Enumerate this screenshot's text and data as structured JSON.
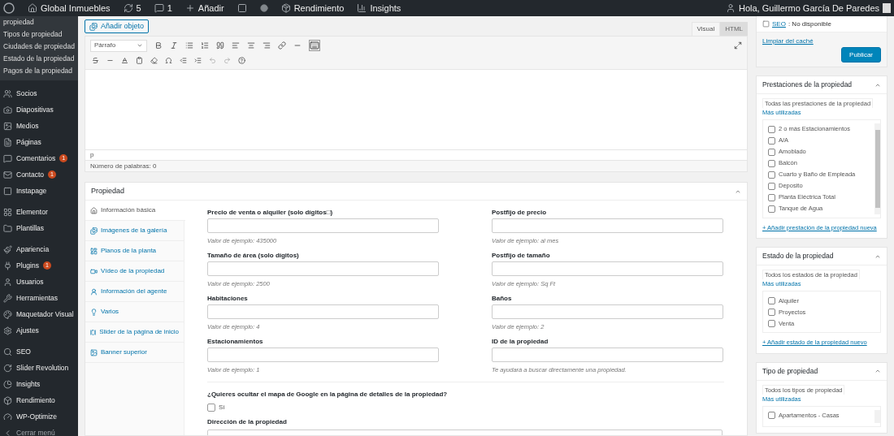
{
  "admin_bar": {
    "site": "Global Inmuebles",
    "updates": "5",
    "comments": "1",
    "new": "Añadir",
    "performance": "Rendimiento",
    "insights": "Insights",
    "greeting": "Hola, Guillermo García De Paredes"
  },
  "sidebar": {
    "submenu": [
      "propiedad",
      "Tipos de propiedad",
      "Ciudades de propiedad",
      "Estado de la propiedad",
      "Pagos de la propiedad"
    ],
    "groups": [
      [
        {
          "label": "Socios"
        },
        {
          "label": "Diapositivas"
        },
        {
          "label": "Medios"
        },
        {
          "label": "Páginas"
        },
        {
          "label": "Comentarios",
          "badge": "1"
        },
        {
          "label": "Contacto",
          "badge": "1"
        },
        {
          "label": "Instapage"
        }
      ],
      [
        {
          "label": "Elementor"
        },
        {
          "label": "Plantillas"
        }
      ],
      [
        {
          "label": "Apariencia"
        },
        {
          "label": "Plugins",
          "badge": "1"
        },
        {
          "label": "Usuarios"
        },
        {
          "label": "Herramientas"
        },
        {
          "label": "Maquetador Visual"
        },
        {
          "label": "Ajustes"
        }
      ],
      [
        {
          "label": "SEO"
        },
        {
          "label": "Slider Revolution"
        },
        {
          "label": "Insights"
        },
        {
          "label": "Rendimiento"
        },
        {
          "label": "WP-Optimize"
        },
        {
          "label": "Cerrar menú",
          "kind": "collapse"
        }
      ]
    ]
  },
  "editor": {
    "add_media": "Añadir objeto",
    "tabs": [
      {
        "label": "Visual",
        "selected": true
      },
      {
        "label": "HTML",
        "selected": false
      }
    ],
    "format": "Párrafo",
    "path": "p",
    "word_count": "Número de palabras: 0"
  },
  "property_box": {
    "title": "Propiedad",
    "tabs": [
      {
        "label": "Información básica",
        "selected": true
      },
      {
        "label": "Imágenes de la galería",
        "selected": false
      },
      {
        "label": "Planos de la planta",
        "selected": false
      },
      {
        "label": "Vídeo de la propiedad",
        "selected": false
      },
      {
        "label": "Información del agente",
        "selected": false
      },
      {
        "label": "Varios",
        "selected": false
      },
      {
        "label": "Slider de la página de inicio",
        "selected": false
      },
      {
        "label": "Banner superior",
        "selected": false
      }
    ],
    "fields": [
      {
        "label": "Precio de venta o alquiler (solo dígitos□)",
        "hint": "Valor de ejemplo: 435000"
      },
      {
        "label": "Postfijo de precio",
        "hint": "Valor de ejemplo: al mes"
      },
      {
        "label": "Tamaño de área (solo dígitos)",
        "hint": "Valor de ejemplo: 2500"
      },
      {
        "label": "Postfijo de tamaño",
        "hint": "Valor de ejemplo: Sq Ft"
      },
      {
        "label": "Habitaciones",
        "hint": "Valor de ejemplo: 4"
      },
      {
        "label": "Baños",
        "hint": "Valor de ejemplo: 2"
      },
      {
        "label": "Estacionamientos",
        "hint": "Valor de ejemplo: 1"
      },
      {
        "label": "ID de la propiedad",
        "hint": "Te ayudará a buscar directamente una propiedad."
      }
    ],
    "map_question": "¿Quieres ocultar el mapa de Google en la página de detalles de la propiedad?",
    "map_option": {
      "label": "Sí",
      "checked": false
    },
    "address_label": "Dirección de la propiedad"
  },
  "publish": {
    "seo_link": "SEO",
    "seo_value": ": No disponible",
    "clear_cache": "Limpiar del caché",
    "publish": "Publicar"
  },
  "taxonomies": [
    {
      "title": "Prestaciones de la propiedad",
      "tabs": [
        {
          "label": "Todas las prestaciones de la propiedad",
          "selected": true
        },
        {
          "label": "Más utilizadas",
          "selected": false
        }
      ],
      "scrollable": true,
      "items": [
        {
          "label": "2 o más Estacionamientos",
          "checked": false
        },
        {
          "label": "A/A",
          "checked": false
        },
        {
          "label": "Amoblado",
          "checked": false
        },
        {
          "label": "Balcón",
          "checked": false
        },
        {
          "label": "Cuarto y Baño de Empleada",
          "checked": false
        },
        {
          "label": "Deposito",
          "checked": false
        },
        {
          "label": "Planta Eléctrica Total",
          "checked": false
        },
        {
          "label": "Tanque de Agua",
          "checked": false
        }
      ],
      "add_link": "+ Añadir prestación de la propiedad nueva"
    },
    {
      "title": "Estado de la propiedad",
      "tabs": [
        {
          "label": "Todos los estados de la propiedad",
          "selected": true
        },
        {
          "label": "Más utilizadas",
          "selected": false
        }
      ],
      "scrollable": false,
      "items": [
        {
          "label": "Alquiler",
          "checked": false
        },
        {
          "label": "Proyectos",
          "checked": false
        },
        {
          "label": "Venta",
          "checked": false
        }
      ],
      "add_link": "+ Añadir estado de la propiedad nuevo"
    },
    {
      "title": "Tipo de propiedad",
      "tabs": [
        {
          "label": "Todos los tipos de propiedad",
          "selected": true
        },
        {
          "label": "Más utilizadas",
          "selected": false
        }
      ],
      "scrollable": true,
      "items": [
        {
          "label": "Apartamentos - Casas",
          "checked": false
        }
      ]
    }
  ]
}
